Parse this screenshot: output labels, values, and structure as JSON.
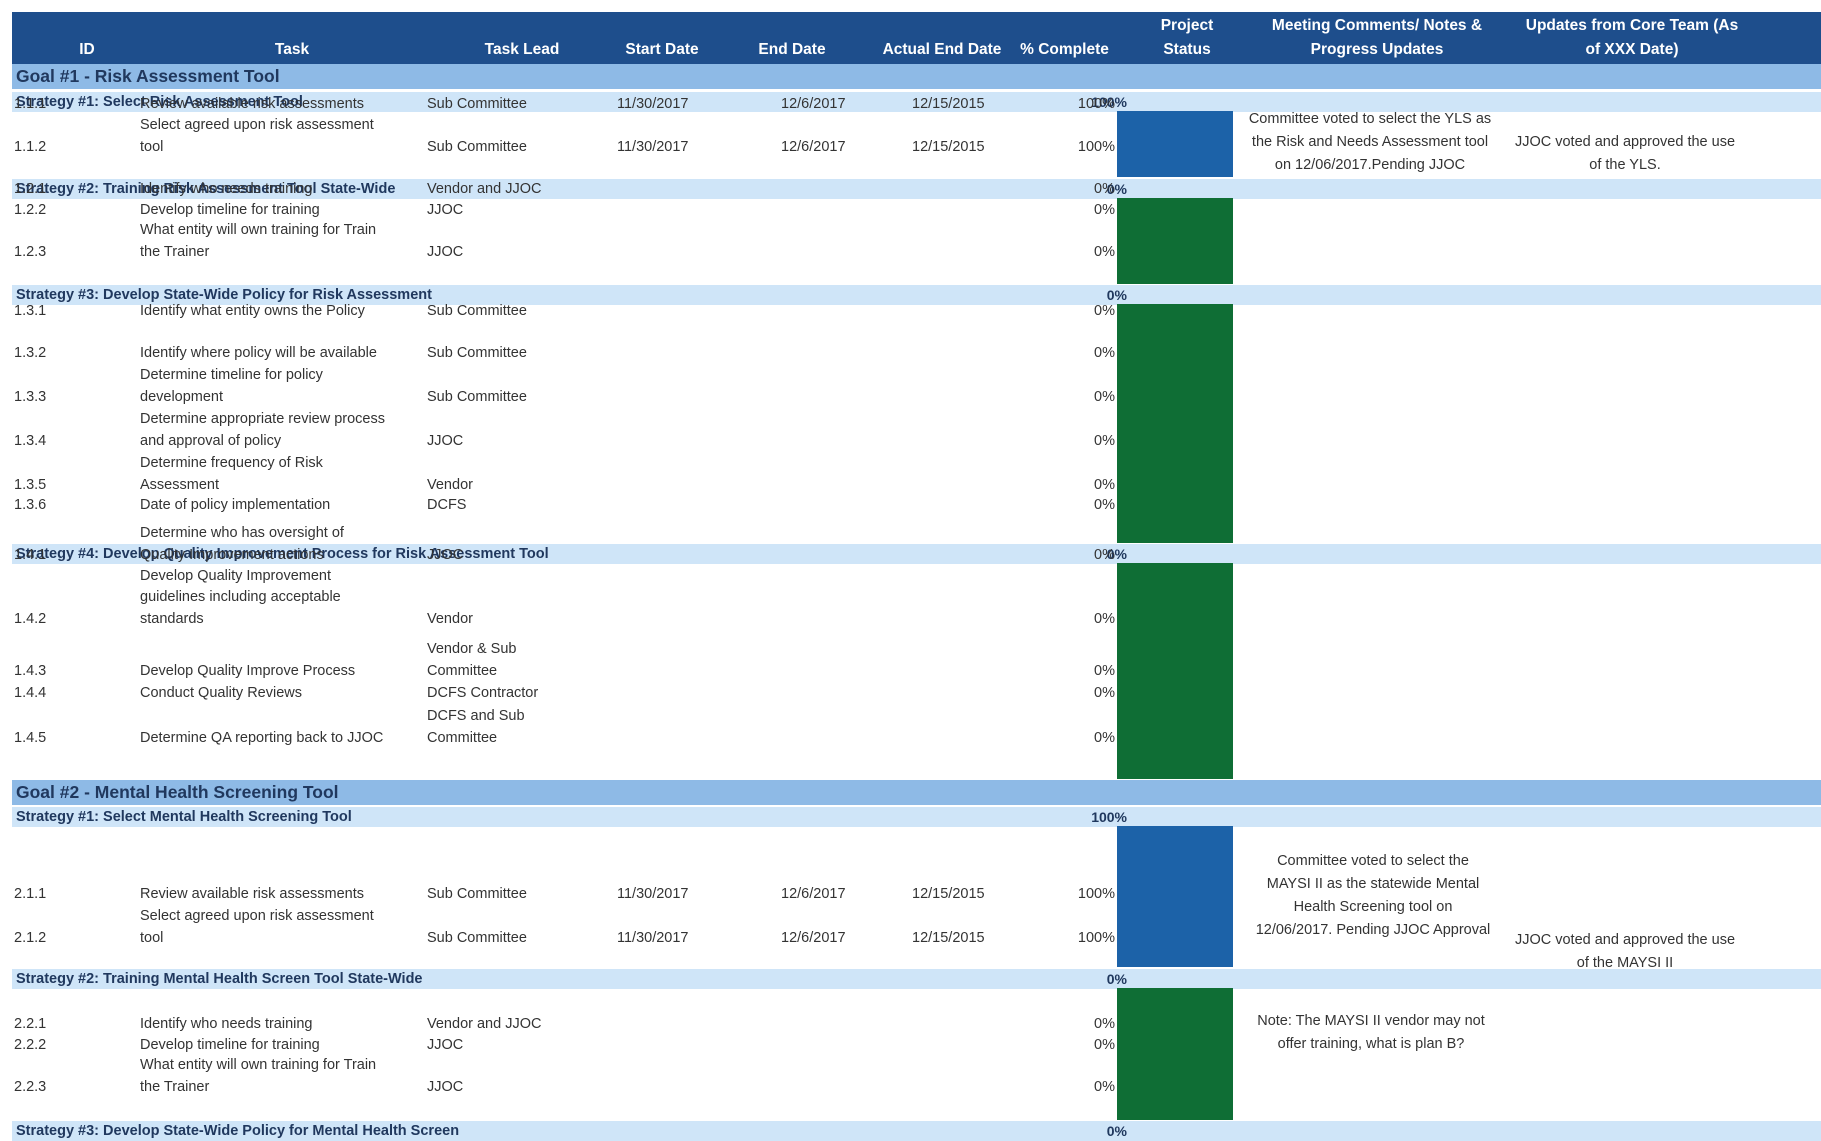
{
  "header": {
    "id": "ID",
    "task": "Task",
    "task_lead": "Task Lead",
    "start_date": "Start Date",
    "end_date": "End Date",
    "actual_end_date": "Actual End Date",
    "pct_complete": "% Complete",
    "project_status": "Project\nStatus",
    "meeting_comments": "Meeting Comments/ Notes &\nProgress Updates",
    "updates_core": "Updates from Core Team (As\nof XXX Date)"
  },
  "status_colors": {
    "complete": "#1c62a8",
    "on_track": "#0f6e35"
  },
  "goals": [
    {
      "title": "Goal #1 - Risk Assessment Tool",
      "strategies": [
        {
          "title": "Strategy #1: Select Risk Assessment Tool",
          "pct": "100%",
          "note": "Committee voted to select the YLS as\nthe Risk and Needs Assessment tool\non 12/06/2017.Pending JJOC",
          "update": "JJOC voted and approved the use\nof the YLS.",
          "tasks": [
            {
              "id": "1.1.1",
              "task": "Review available risk assessments",
              "lead": "Sub Committee",
              "start": "11/30/2017",
              "end": "12/6/2017",
              "actual": "12/15/2015",
              "pct": "100%"
            },
            {
              "id": "1.1.2",
              "task": "Select agreed upon risk assessment\ntool",
              "lead": "Sub Committee",
              "start": "11/30/2017",
              "end": "12/6/2017",
              "actual": "12/15/2015",
              "pct": "100%"
            }
          ]
        },
        {
          "title": "Strategy #2: Training Risk Assessment Tool State-Wide",
          "pct": "0%",
          "tasks": [
            {
              "id": "1.2.1",
              "task": "Identify who needs training",
              "lead": "Vendor and JJOC",
              "pct": "0%"
            },
            {
              "id": "1.2.2",
              "task": "Develop timeline for training",
              "lead": "JJOC",
              "pct": "0%"
            },
            {
              "id": "1.2.3",
              "task": "What entity will own training for Train\nthe Trainer",
              "lead": "JJOC",
              "pct": "0%"
            }
          ]
        },
        {
          "title": "Strategy #3: Develop State-Wide Policy for Risk Assessment",
          "pct": "0%",
          "tasks": [
            {
              "id": "1.3.1",
              "task": "Identify what entity owns the Policy",
              "lead": "Sub Committee",
              "pct": "0%"
            },
            {
              "id": "1.3.2",
              "task": "Identify where policy will be available",
              "lead": "Sub Committee",
              "pct": "0%"
            },
            {
              "id": "1.3.3",
              "task": "Determine timeline for policy\ndevelopment",
              "lead": "Sub Committee",
              "pct": "0%"
            },
            {
              "id": "1.3.4",
              "task": "Determine appropriate review process\nand approval of policy",
              "lead": "JJOC",
              "pct": "0%"
            },
            {
              "id": "1.3.5",
              "task": "Determine frequency of Risk\nAssessment",
              "lead": "Vendor",
              "pct": "0%"
            },
            {
              "id": "1.3.6",
              "task": "Date of policy implementation",
              "lead": "DCFS",
              "pct": "0%"
            }
          ]
        },
        {
          "title": "Strategy #4: Develop Quality Improvement Process for Risk Assessment Tool",
          "pct": "0%",
          "tasks": [
            {
              "id": "1.4.1",
              "task": "Determine who has oversight of\nQuality Improvement actions",
              "lead": "JJOC",
              "pct": "0%"
            },
            {
              "id": "1.4.2",
              "task": "Develop Quality Improvement\nguidelines including acceptable\nstandards",
              "lead": "Vendor",
              "pct": "0%"
            },
            {
              "id": "1.4.3",
              "task": "Develop Quality Improve Process",
              "lead": "Vendor & Sub\nCommittee",
              "pct": "0%"
            },
            {
              "id": "1.4.4",
              "task": "Conduct Quality Reviews",
              "lead": "DCFS Contractor",
              "pct": "0%"
            },
            {
              "id": "1.4.5",
              "task": "Determine QA reporting back to JJOC",
              "lead": "DCFS and Sub\nCommittee",
              "pct": "0%"
            }
          ]
        }
      ]
    },
    {
      "title": "Goal #2 - Mental Health Screening Tool",
      "strategies": [
        {
          "title": "Strategy #1: Select Mental Health Screening Tool",
          "pct": "100%",
          "note": "Committee voted to select the\nMAYSI II as the statewide Mental\nHealth Screening tool on\n12/06/2017.  Pending JJOC Approval",
          "update": "JJOC voted and approved the use\nof the MAYSI II",
          "tasks": [
            {
              "id": "2.1.1",
              "task": "Review available risk assessments",
              "lead": "Sub Committee",
              "start": "11/30/2017",
              "end": "12/6/2017",
              "actual": "12/15/2015",
              "pct": "100%"
            },
            {
              "id": "2.1.2",
              "task": "Select agreed upon risk assessment\ntool",
              "lead": "Sub Committee",
              "start": "11/30/2017",
              "end": "12/6/2017",
              "actual": "12/15/2015",
              "pct": "100%"
            }
          ]
        },
        {
          "title": "Strategy #2: Training Mental Health Screen Tool State-Wide",
          "pct": "0%",
          "note": "Note: The MAYSI II vendor may not\noffer training, what is plan B?",
          "tasks": [
            {
              "id": "2.2.1",
              "task": "Identify who needs training",
              "lead": "Vendor and JJOC",
              "pct": "0%"
            },
            {
              "id": "2.2.2",
              "task": "Develop timeline for training",
              "lead": "JJOC",
              "pct": "0%"
            },
            {
              "id": "2.2.3",
              "task": "What entity will own training for Train\nthe Trainer",
              "lead": "JJOC",
              "pct": "0%"
            }
          ]
        },
        {
          "title": "Strategy #3: Develop State-Wide Policy for Mental Health Screen",
          "pct": "0%",
          "tasks": []
        }
      ]
    }
  ]
}
